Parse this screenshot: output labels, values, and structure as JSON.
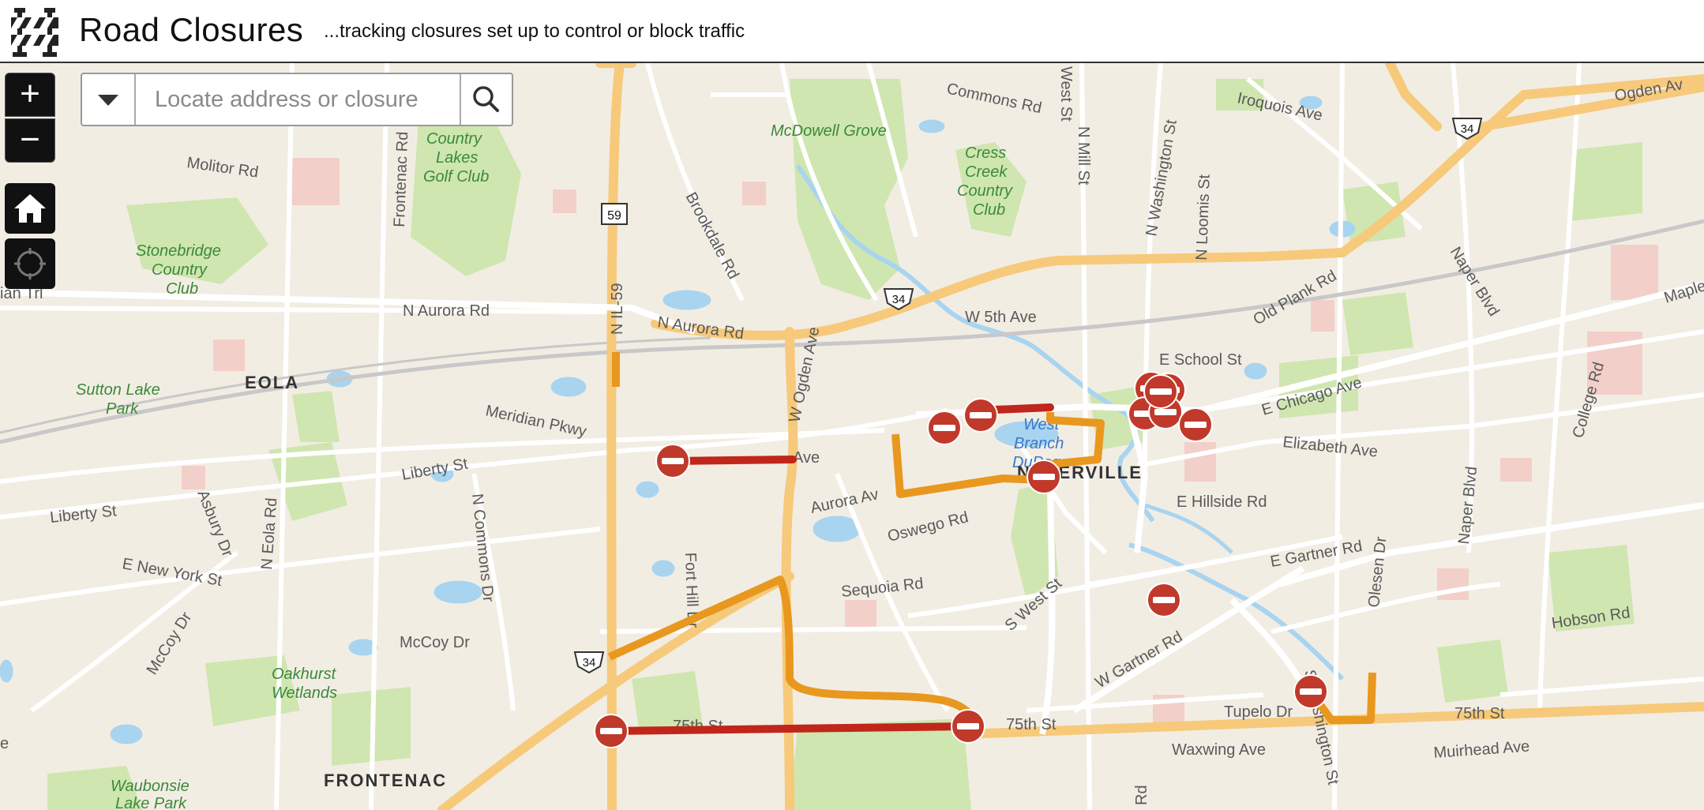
{
  "header": {
    "title": "Road Closures",
    "subtitle": "...tracking closures set up to control or block traffic",
    "logo_icon": "road-barrier-icon"
  },
  "map_controls": {
    "zoom_in": "+",
    "zoom_out": "−",
    "home_icon": "home-icon",
    "locate_icon": "locate-icon"
  },
  "search": {
    "placeholder": "Locate address or closure",
    "dropdown_icon": "chevron-down-icon",
    "button_icon": "search-icon"
  },
  "colors": {
    "closure_marker": "#c0392b",
    "full_closure_line": "#c0261a",
    "detour_line": "#e8981e",
    "highway": "#f7c97a",
    "park": "#cfe6b0",
    "water": "#a8d4f0"
  },
  "map": {
    "labels": {
      "road_59": "59",
      "road_34a": "34",
      "road_34b": "34",
      "road_34c": "34",
      "commons_rd": "Commons Rd",
      "mcdowell_grove": "McDowell Grove",
      "cress_creek_1": "Cress",
      "cress_creek_2": "Creek",
      "cress_creek_3": "Country",
      "cress_creek_4": "Club",
      "iroquois": "Iroquois Ave",
      "ogden_ave_e": "Ogden Av",
      "country_lakes_1": "Country",
      "country_lakes_2": "Lakes",
      "country_lakes_3": "Golf Club",
      "molitor": "Molitor Rd",
      "frontenac_rd": "Frontenac Rd",
      "brookdale": "Brookdale Rd",
      "n_mill": "N Mill St",
      "n_washington": "N Washington St",
      "n_loomis": "N Loomis St",
      "west_st_n": "West St",
      "stonebridge_1": "Stonebridge",
      "stonebridge_2": "Country",
      "stonebridge_3": "Club",
      "ian_trl": "ian Trl",
      "n_aurora_w": "N Aurora Rd",
      "n_aurora_e": "N Aurora Rd",
      "n_il59": "N IL-59",
      "w_ogden": "W Ogden Ave",
      "w_5th": "W 5th Ave",
      "old_plank": "Old Plank Rd",
      "naper_blvd_n": "Naper Blvd",
      "maple": "Maple",
      "college_rd": "College Rd",
      "e_school": "E School St",
      "e_chicago": "E Chicago Ave",
      "elizabeth": "Elizabeth Ave",
      "sutton_1": "Sutton Lake",
      "sutton_2": "Park",
      "eola": "EOLA",
      "meridian": "Meridian Pkwy",
      "liberty_e": "Liberty St",
      "liberty_w": "Liberty St",
      "jeff_ave": "Ave",
      "w_branch_1": "West",
      "w_branch_2": "Branch",
      "w_branch_3": "DuPage",
      "naperville": "NAPERVILLE",
      "aurora_ave": "Aurora Av",
      "e_hillside": "E Hillside Rd",
      "asbury": "Asbury Dr",
      "n_eola": "N Eola Rd",
      "n_commons": "N Commons Dr",
      "oswego": "Oswego Rd",
      "e_new_york": "E New York St",
      "fort_hill": "Fort Hill Dr",
      "sequoia": "Sequoia Rd",
      "e_gartner": "E Gartner Rd",
      "olesen": "Olesen Dr",
      "naper_blvd_s": "Naper Blvd",
      "mccoy_w": "McCoy Dr",
      "mccoy_e": "McCoy Dr",
      "s_west": "S West St",
      "hobson": "Hobson Rd",
      "oakhurst_1": "Oakhurst",
      "oakhurst_2": "Wetlands",
      "w_gartner": "W Gartner Rd",
      "washington_s": "S Washington St",
      "75th_w": "75th St",
      "75th_e": "75th St",
      "75th_c": "75th St",
      "tupelo": "Tupelo Dr",
      "waxwing": "Waxwing Ave",
      "muirhead": "Muirhead Ave",
      "frontenac": "FRONTENAC",
      "waubonsie_1": "Waubonsie",
      "waubonsie_2": "Lake Park",
      "ridge_rd": "Rd",
      "frontenac_e": "e"
    }
  }
}
